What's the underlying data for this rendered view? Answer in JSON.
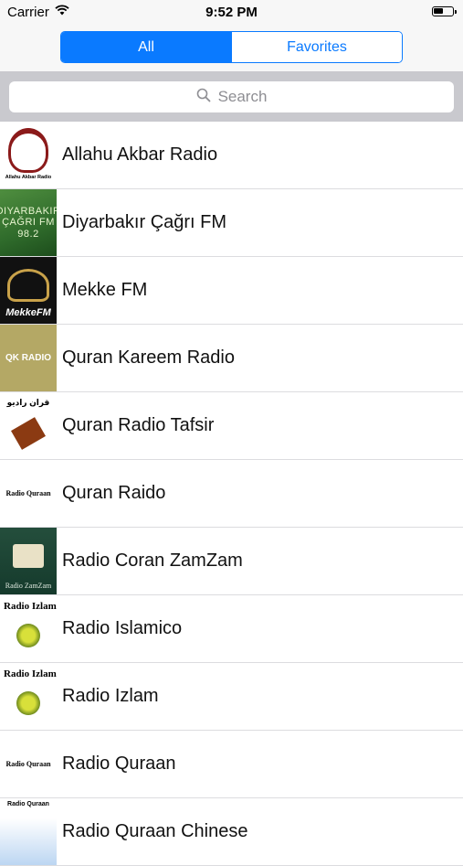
{
  "status_bar": {
    "carrier": "Carrier",
    "time": "9:52 PM",
    "battery_level": 0.55
  },
  "segments": [
    {
      "label": "All",
      "selected": true
    },
    {
      "label": "Favorites",
      "selected": false
    }
  ],
  "search": {
    "placeholder": "Search"
  },
  "stations": [
    {
      "name": "Allahu Akbar Radio",
      "logo_text": "Allahu Akbar Radio"
    },
    {
      "name": "Diyarbakır Çağrı FM",
      "logo_text": "DIYARBAKIR ÇAĞRI FM 98.2"
    },
    {
      "name": "Mekke FM",
      "logo_text": "MekkeFM"
    },
    {
      "name": "Quran Kareem Radio",
      "logo_text": "QK RADIO"
    },
    {
      "name": "Quran Radio Tafsir",
      "logo_text": "قران راديو"
    },
    {
      "name": "Quran Raido",
      "logo_text": "Radio Quraan"
    },
    {
      "name": "Radio Coran ZamZam",
      "logo_text": "Radio ZamZam"
    },
    {
      "name": "Radio Islamico",
      "logo_text": "Radio Izlam"
    },
    {
      "name": "Radio Izlam",
      "logo_text": "Radio Izlam"
    },
    {
      "name": "Radio Quraan",
      "logo_text": "Radio Quraan"
    },
    {
      "name": "Radio Quraan Chinese",
      "logo_text": "Radio Quraan"
    }
  ],
  "colors": {
    "accent": "#0a7aff",
    "separator": "#dcdcdf",
    "search_bar_bg": "#c9c9ce"
  }
}
